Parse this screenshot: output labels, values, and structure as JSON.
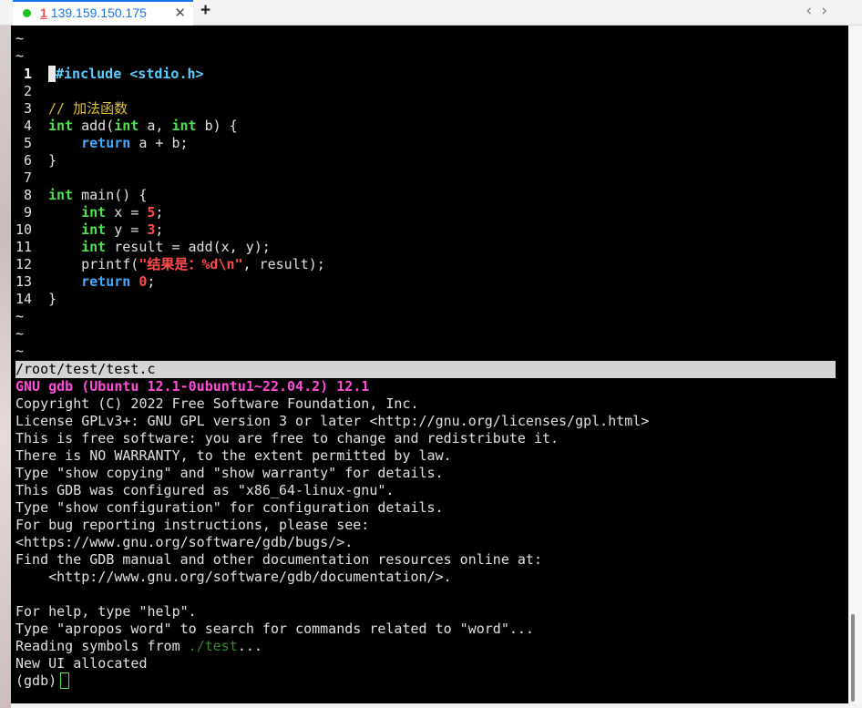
{
  "tab": {
    "number": "1",
    "host": "139.159.150.175",
    "close_glyph": "✕",
    "status_color": "#19c219"
  },
  "new_tab_glyph": "+",
  "nav": {
    "back_glyph": "‹",
    "forward_glyph": "›"
  },
  "editor": {
    "tilde": "~",
    "lines": [
      {
        "n": "1",
        "code": "#include <stdio.h>"
      },
      {
        "n": "2",
        "code": ""
      },
      {
        "n": "3",
        "code": "// 加法函数"
      },
      {
        "n": "4",
        "code": "int add(int a, int b) {"
      },
      {
        "n": "5",
        "code": "    return a + b;"
      },
      {
        "n": "6",
        "code": "}"
      },
      {
        "n": "7",
        "code": ""
      },
      {
        "n": "8",
        "code": "int main() {"
      },
      {
        "n": "9",
        "code": "    int x = 5;"
      },
      {
        "n": "10",
        "code": "    int y = 3;"
      },
      {
        "n": "11",
        "code": "    int result = add(x, y);"
      },
      {
        "n": "12",
        "code": "    printf(\"结果是：%d\\n\", result);"
      },
      {
        "n": "13",
        "code": "    return 0;"
      },
      {
        "n": "14",
        "code": "}"
      }
    ],
    "file_path": "/root/test/test.c"
  },
  "gdb": {
    "title": "GNU gdb (Ubuntu 12.1-0ubuntu1~22.04.2) 12.1",
    "lines": [
      "Copyright (C) 2022 Free Software Foundation, Inc.",
      "License GPLv3+: GNU GPL version 3 or later <http://gnu.org/licenses/gpl.html>",
      "This is free software: you are free to change and redistribute it.",
      "There is NO WARRANTY, to the extent permitted by law.",
      "Type \"show copying\" and \"show warranty\" for details.",
      "This GDB was configured as \"x86_64-linux-gnu\".",
      "Type \"show configuration\" for configuration details.",
      "For bug reporting instructions, please see:",
      "<https://www.gnu.org/software/gdb/bugs/>.",
      "Find the GDB manual and other documentation resources online at:",
      "    <http://www.gnu.org/software/gdb/documentation/>.",
      "",
      "For help, type \"help\".",
      "Type \"apropos word\" to search for commands related to \"word\"..."
    ],
    "reading_prefix": "Reading symbols from ",
    "reading_path": "./test",
    "reading_suffix": "...",
    "ui_line": "New UI allocated",
    "prompt": "(gdb)"
  }
}
